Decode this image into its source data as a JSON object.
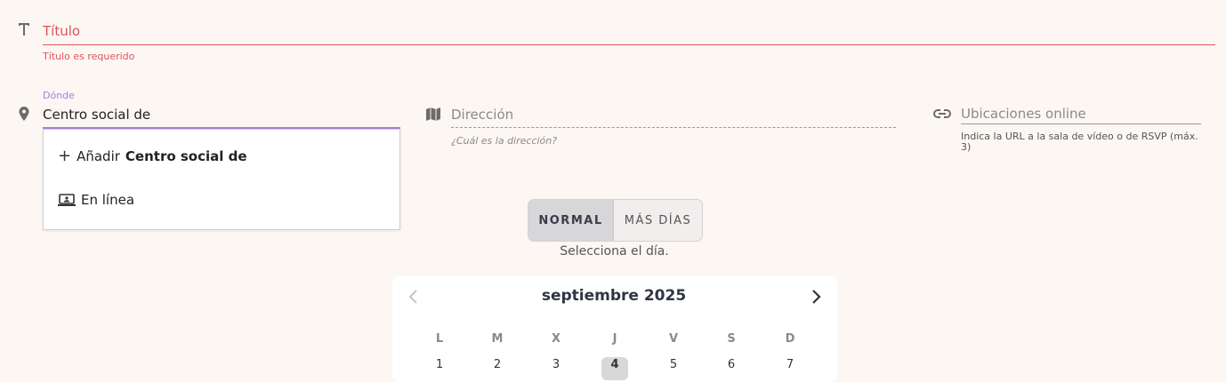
{
  "title_field": {
    "placeholder": "Título",
    "error": "Título es requerido"
  },
  "where_field": {
    "label": "Dónde",
    "value": "Centro social de",
    "suggestions": {
      "add_prefix": "Añadir",
      "add_term": "Centro social de",
      "online": "En línea"
    }
  },
  "address_field": {
    "placeholder": "Dirección",
    "help": "¿Cuál es la dirección?"
  },
  "online_field": {
    "placeholder": "Ubicaciones online",
    "help": "Indica la URL a la sala de vídeo o de RSVP (máx. 3)"
  },
  "mode_toggle": {
    "normal": "NORMAL",
    "multi": "MÁS DÍAS",
    "hint": "Selecciona el día."
  },
  "calendar": {
    "month": "septiembre 2025",
    "weekdays": [
      "L",
      "M",
      "X",
      "J",
      "V",
      "S",
      "D"
    ],
    "first_row": [
      "1",
      "2",
      "3",
      "4",
      "5",
      "6",
      "7"
    ],
    "selected_day": "4"
  },
  "icons": {
    "title": "text-icon",
    "where": "map-pin-icon",
    "address": "map-icon",
    "online": "link-icon",
    "add": "plus-icon",
    "online_option": "laptop-icon",
    "prev": "chevron-left-icon",
    "next": "chevron-right-icon"
  },
  "colors": {
    "error": "#e0525c",
    "focus": "#a57ee2",
    "background": "#fcf7f3"
  }
}
